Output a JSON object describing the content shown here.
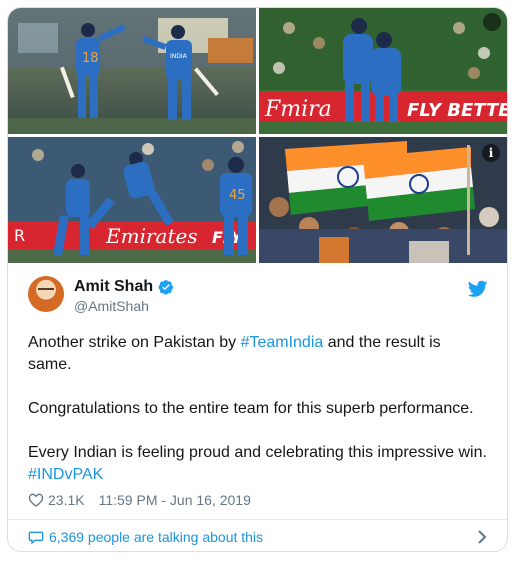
{
  "tweet": {
    "author": {
      "name": "Amit Shah",
      "handle": "@AmitShah",
      "verified": true
    },
    "paragraphs": [
      {
        "before": "Another strike on Pakistan by ",
        "hashtag": "#TeamIndia",
        "after": " and the result is same."
      },
      {
        "text": "Congratulations to the entire team for this superb performance."
      },
      {
        "before": "Every Indian is feeling proud and celebrating this impressive win. ",
        "hashtag": "#INDvPAK"
      }
    ],
    "likes": "23.1K",
    "timestamp": "11:59 PM - Jun 16, 2019",
    "talking": "6,369 people are talking about this"
  },
  "photos": [
    {
      "alt_label": "cricket-celebration-1",
      "banner": "",
      "jersey_numbers": [
        "18",
        ""
      ]
    },
    {
      "alt_label": "cricket-celebration-2",
      "banner": "Fmira FLY BETTER"
    },
    {
      "alt_label": "cricket-celebration-3",
      "banner": "Emirates FLY",
      "jersey_numbers": [
        "45"
      ]
    },
    {
      "alt_label": "fans-with-flags",
      "banner": ""
    }
  ],
  "colors": {
    "accent": "#1b95e0",
    "text": "#14171a",
    "secondary": "#657786",
    "border": "#d9dfe3",
    "jersey": "#2c6fc2",
    "banner_red": "#d7262f"
  },
  "icons": {
    "info": "info-icon",
    "verified": "verified-badge-icon",
    "twitter": "twitter-bird-icon",
    "like": "heart-icon",
    "reply": "speech-bubble-icon",
    "more": "chevron-right-icon"
  }
}
